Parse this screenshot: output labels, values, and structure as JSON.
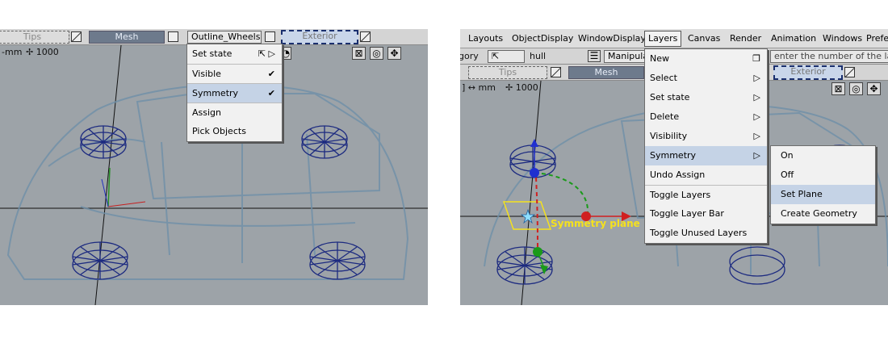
{
  "left": {
    "toolbar": {
      "tips": "Tips",
      "mesh": "Mesh",
      "outline": "Outline_Wheels",
      "exterior": "Exterior"
    },
    "units": "mm",
    "grid_value": "1000",
    "layer_menu": {
      "items": [
        {
          "label": "Set state"
        },
        {
          "label": "Visible",
          "check": "✔"
        },
        {
          "label": "Symmetry",
          "check": "✔"
        },
        {
          "label": "Assign"
        },
        {
          "label": "Pick Objects"
        }
      ]
    }
  },
  "right": {
    "menubar": [
      "Layouts",
      "ObjectDisplay",
      "WindowDisplay",
      "Layers",
      "Canvas",
      "Render",
      "Animation",
      "Windows",
      "Prefe"
    ],
    "row1": {
      "gory": "gory",
      "hull": "hull",
      "manipulat": "Manipulat",
      "prompt": "enter the number of the layer"
    },
    "row2": {
      "tips": "Tips",
      "mesh": "Mesh",
      "exterior": "Exterior"
    },
    "units": "mm",
    "grid_value": "1000",
    "symmetry_label": "Symmetry plane",
    "layers_menu": {
      "items": [
        "New",
        "Select",
        "Set state",
        "Delete",
        "Visibility",
        "Symmetry",
        "Undo Assign",
        "Toggle Layers",
        "Toggle Layer Bar",
        "Toggle Unused Layers"
      ]
    },
    "symmetry_submenu": {
      "items": [
        "On",
        "Off",
        "Set Plane",
        "Create Geometry"
      ]
    }
  },
  "colors": {
    "viewport": "#9da3a8",
    "wireframe": "#1c2a80",
    "highlight": "#c5d3e6",
    "symmetry_label": "#f5e11e"
  }
}
